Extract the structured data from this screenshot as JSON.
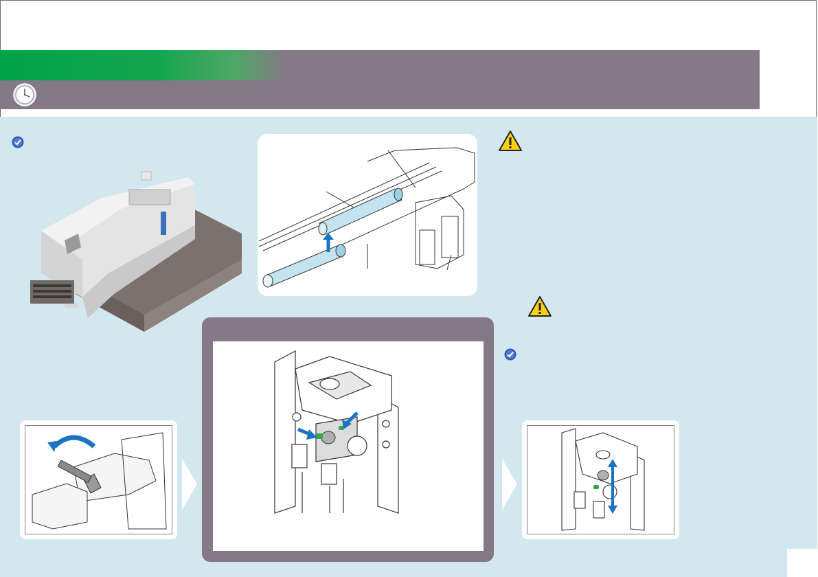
{
  "page": {
    "header_title": "",
    "time_label": "",
    "page_number": ""
  },
  "icons": {
    "clock": "clock-icon",
    "check": "check-icon",
    "warning": "warning-icon",
    "next": "next-arrow-icon"
  },
  "colors": {
    "header_green": "#00a24a",
    "header_gray": "#857887",
    "background": "#d2e7ee",
    "accent_blue": "#1a73c4",
    "marker_green": "#2fa84f",
    "warning_yellow": "#f7d117"
  }
}
